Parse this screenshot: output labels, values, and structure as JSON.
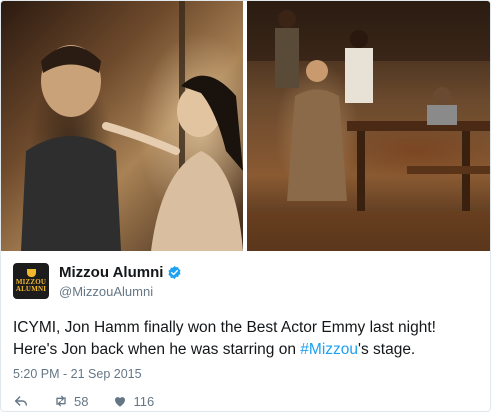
{
  "photos": {
    "left": {
      "icon": "photo-theater-couple"
    },
    "right": {
      "icon": "photo-theater-cast"
    }
  },
  "author": {
    "avatar_line1": "MIZZOU",
    "avatar_line2": "ALUMNI",
    "display_name": "Mizzou Alumni",
    "handle": "@MizzouAlumni",
    "verified_icon": "verified-badge-icon"
  },
  "tweet": {
    "text_before": "ICYMI, Jon Hamm finally won the Best Actor Emmy last night! Here's Jon back when he was starring on ",
    "hashtag": "#Mizzou",
    "text_after": "'s stage.",
    "timestamp": "5:20 PM - 21 Sep 2015"
  },
  "actions": {
    "reply_icon": "reply-icon",
    "retweet_icon": "retweet-icon",
    "retweet_count": "58",
    "like_icon": "heart-icon",
    "like_count": "116"
  },
  "colors": {
    "link": "#1da1f2",
    "muted": "#657786",
    "text": "#14171a",
    "brand_gold": "#f1b82d"
  }
}
